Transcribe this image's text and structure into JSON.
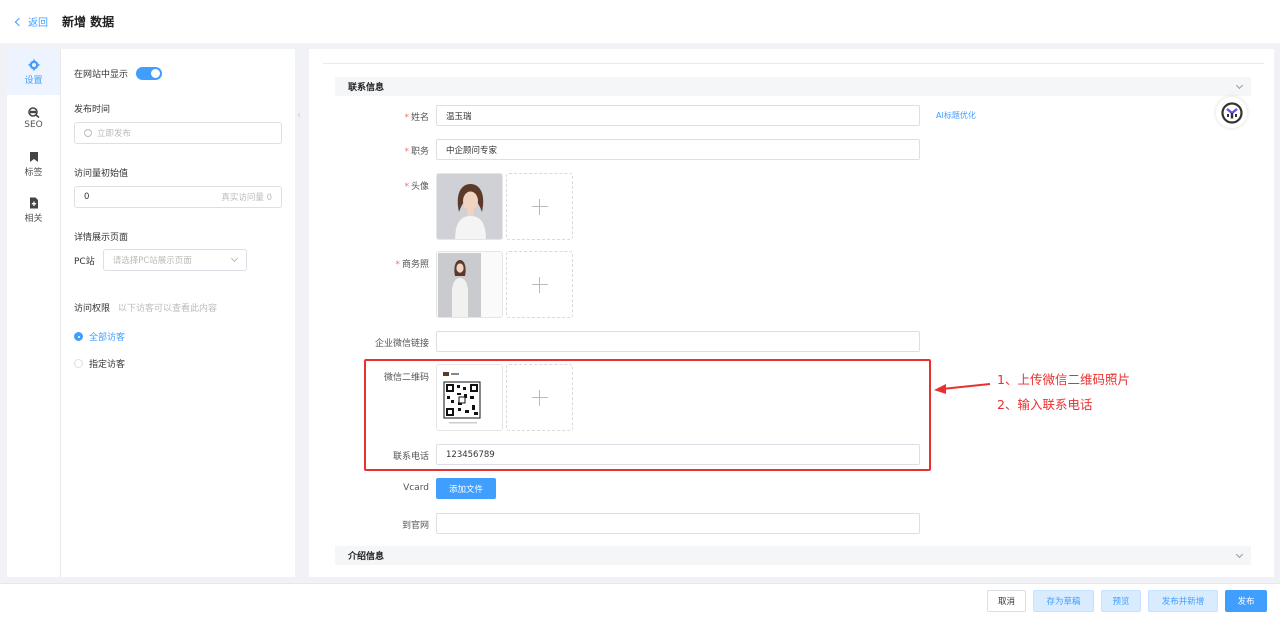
{
  "topbar": {
    "back_label": "返回",
    "title": "新增 数据"
  },
  "rail": [
    {
      "label": "设置",
      "icon": "gear-icon"
    },
    {
      "label": "SEO",
      "icon": "seo-icon"
    },
    {
      "label": "标签",
      "icon": "bookmark-icon"
    },
    {
      "label": "相关",
      "icon": "add-file-icon"
    }
  ],
  "settings": {
    "show_on_site_label": "在网站中显示",
    "publish_time_label": "发布时间",
    "publish_time_placeholder": "立即发布",
    "initial_views_label": "访问量初始值",
    "initial_views_value": "0",
    "real_views_text": "真实访问量 0",
    "detail_page_label": "详情展示页面",
    "pc_label": "PC站",
    "pc_placeholder": "请选择PC站展示页面",
    "access_label": "访问权限",
    "access_hint": "以下访客可以查看此内容",
    "access_all": "全部访客",
    "access_specified": "指定访客"
  },
  "form": {
    "contact_section": "联系信息",
    "name_label": "姓名",
    "name_value": "温玉瑞",
    "ai_link": "AI标题优化",
    "position_label": "职务",
    "position_value": "中企顾问专家",
    "avatar_label": "头像",
    "business_photo_label": "商务照",
    "wecom_link_label": "企业微信链接",
    "wechat_qr_label": "微信二维码",
    "phone_label": "联系电话",
    "phone_value": "123456789",
    "vcard_label": "Vcard",
    "add_file_button": "添加文件",
    "website_label": "到官网",
    "intro_section": "介绍信息"
  },
  "annotation": {
    "line1": "1、上传微信二维码照片",
    "line2": "2、输入联系电话",
    "color": "#e8312f"
  },
  "bottom": {
    "cancel": "取消",
    "save_draft": "存为草稿",
    "preview": "预览",
    "publish_and_new": "发布并新增",
    "publish": "发布"
  },
  "colors": {
    "accent": "#409eff",
    "required": "#f56c6c",
    "annotation": "#e8312f"
  }
}
